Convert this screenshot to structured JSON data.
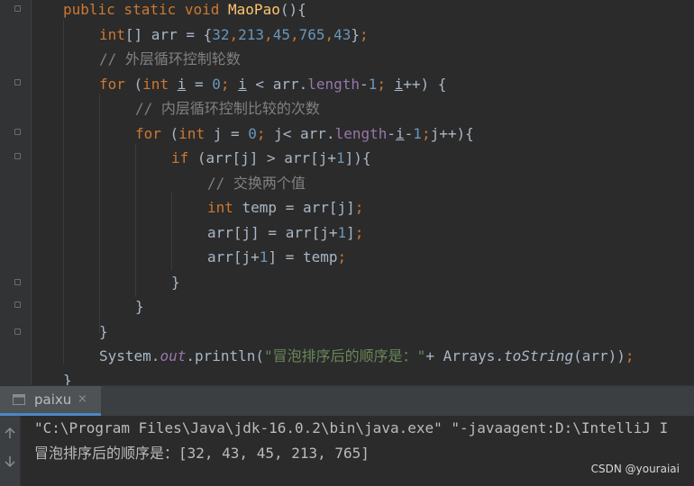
{
  "editor": {
    "lines": [
      [
        [
          "kw",
          "public static void "
        ],
        [
          "fn",
          "MaoPao"
        ],
        [
          "t",
          "(){"
        ]
      ],
      [
        [
          "kw",
          "int"
        ],
        [
          "t",
          "[] arr = {"
        ],
        [
          "num",
          "32"
        ],
        [
          "kw",
          ","
        ],
        [
          "num",
          "213"
        ],
        [
          "kw",
          ","
        ],
        [
          "num",
          "45"
        ],
        [
          "kw",
          ","
        ],
        [
          "num",
          "765"
        ],
        [
          "kw",
          ","
        ],
        [
          "num",
          "43"
        ],
        [
          "t",
          "}"
        ],
        [
          "kw",
          ";"
        ]
      ],
      [
        [
          "cm",
          "// 外层循环控制轮数"
        ]
      ],
      [
        [
          "kw",
          "for "
        ],
        [
          "t",
          "("
        ],
        [
          "kw",
          "int "
        ],
        [
          "ul",
          "i"
        ],
        [
          "t",
          " = "
        ],
        [
          "num",
          "0"
        ],
        [
          "kw",
          "; "
        ],
        [
          "ul",
          "i"
        ],
        [
          "t",
          " < arr."
        ],
        [
          "fld",
          "length"
        ],
        [
          "t",
          "-"
        ],
        [
          "num",
          "1"
        ],
        [
          "kw",
          "; "
        ],
        [
          "ul",
          "i"
        ],
        [
          "t",
          "++) {"
        ]
      ],
      [
        [
          "cm",
          "// 内层循环控制比较的次数"
        ]
      ],
      [
        [
          "kw",
          "for "
        ],
        [
          "t",
          "("
        ],
        [
          "kw",
          "int "
        ],
        [
          "t",
          "j = "
        ],
        [
          "num",
          "0"
        ],
        [
          "kw",
          "; "
        ],
        [
          "t",
          "j< arr."
        ],
        [
          "fld",
          "length"
        ],
        [
          "t",
          "-"
        ],
        [
          "ul",
          "i"
        ],
        [
          "t",
          "-"
        ],
        [
          "num",
          "1"
        ],
        [
          "kw",
          ";"
        ],
        [
          "t",
          "j++){"
        ]
      ],
      [
        [
          "kw",
          "if "
        ],
        [
          "t",
          "(arr[j] > arr[j+"
        ],
        [
          "num",
          "1"
        ],
        [
          "t",
          "]){"
        ]
      ],
      [
        [
          "cm",
          "// 交换两个值"
        ]
      ],
      [
        [
          "kw",
          "int "
        ],
        [
          "t",
          "temp = arr[j]"
        ],
        [
          "kw",
          ";"
        ]
      ],
      [
        [
          "t",
          "arr[j] = arr[j+"
        ],
        [
          "num",
          "1"
        ],
        [
          "t",
          "]"
        ],
        [
          "kw",
          ";"
        ]
      ],
      [
        [
          "t",
          "arr[j+"
        ],
        [
          "num",
          "1"
        ],
        [
          "t",
          "] = temp"
        ],
        [
          "kw",
          ";"
        ]
      ],
      [
        [
          "t",
          "}"
        ]
      ],
      [
        [
          "t",
          "}"
        ]
      ],
      [
        [
          "t",
          "}"
        ]
      ],
      [
        [
          "t",
          "System."
        ],
        [
          "field",
          "out"
        ],
        [
          "t",
          ".println("
        ],
        [
          "str",
          "\"冒泡排序后的顺序是：\""
        ],
        [
          "t",
          "+ Arrays."
        ],
        [
          "it",
          "toString"
        ],
        [
          "t",
          "(arr))"
        ],
        [
          "kw",
          ";"
        ]
      ],
      [
        [
          "t",
          "}"
        ]
      ]
    ]
  },
  "run_panel": {
    "tab_label": "paixu",
    "close_glyph": "×",
    "console_lines": [
      "\"C:\\Program Files\\Java\\jdk-16.0.2\\bin\\java.exe\" \"-javaagent:D:\\IntelliJ I",
      "冒泡排序后的顺序是：[32, 43, 45, 213, 765]"
    ]
  },
  "watermark": "CSDN @youraiai",
  "icons": {
    "run_tab": "run-config-icon",
    "toolbar": [
      "arrow-up-icon",
      "arrow-down-icon"
    ]
  },
  "colors": {
    "keyword": "#cc7832",
    "method": "#ffc66d",
    "number": "#6897bb",
    "comment": "#808080",
    "field": "#9876aa",
    "string": "#6a8759",
    "text": "#a9b7c6",
    "background": "#2b2b2b",
    "accent": "#4a88c7"
  }
}
